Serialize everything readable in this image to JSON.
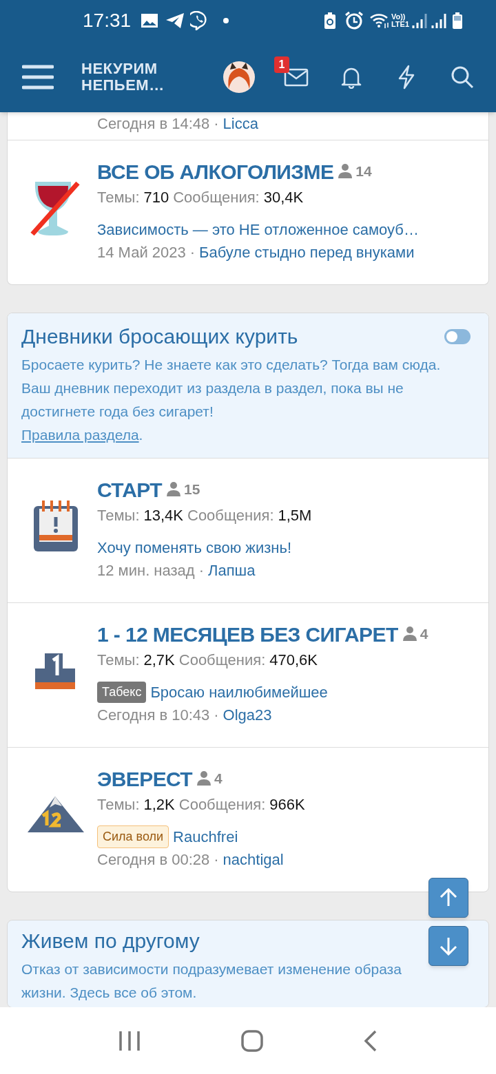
{
  "status_bar": {
    "time": "17:31",
    "volte": "Vo))",
    "network": "LTE1"
  },
  "header": {
    "logo": "НЕКУРИМ НЕПЬЕМ…",
    "inbox_badge": "1"
  },
  "sections": [
    {
      "forums": [
        {
          "kind": "partial",
          "date": "Сегодня в 14:48",
          "separator": "·",
          "author": "Licca"
        },
        {
          "kind": "full",
          "title": "ВСЕ ОБ АЛКОГОЛИЗМЕ",
          "viewers": "14",
          "topics_label": "Темы:",
          "topics": "710",
          "messages_label": "Сообщения:",
          "messages": "30,4K",
          "last_title": "Зависимость — это НЕ отложенное самоуб…",
          "date": "14 Май 2023",
          "separator": "·",
          "author": "Бабуле стыдно перед внуками"
        }
      ]
    },
    {
      "title": "Дневники бросающих курить",
      "collapsed": false,
      "description": "Бросаете курить? Не знаете как это сделать? Тогда вам сюда. Ваш дневник переходит из раздела в раздел, пока вы не достигнете года без сигарет!",
      "rules_link": "Правила раздела",
      "rules_suffix": ".",
      "forums": [
        {
          "kind": "full",
          "title": "СТАРТ",
          "viewers": "15",
          "topics_label": "Темы:",
          "topics": "13,4K",
          "messages_label": "Сообщения:",
          "messages": "1,5M",
          "last_title": "Хочу поменять свою жизнь!",
          "date": "12 мин. назад",
          "separator": "·",
          "author": "Лапша"
        },
        {
          "kind": "full",
          "title": "1 - 12 МЕСЯЦЕВ БЕЗ СИГАРЕТ",
          "viewers": "4",
          "topics_label": "Темы:",
          "topics": "2,7K",
          "messages_label": "Сообщения:",
          "messages": "470,6K",
          "prefix": {
            "label": "Табекс",
            "color": "#777777"
          },
          "last_title": "Бросаю наилюбимейшее",
          "date": "Сегодня в 10:43",
          "separator": "·",
          "author": "Olga23"
        },
        {
          "kind": "full",
          "title": "ЭВЕРЕСТ",
          "viewers": "4",
          "topics_label": "Темы:",
          "topics": "1,2K",
          "messages_label": "Сообщения:",
          "messages": "966K",
          "prefix": {
            "label": "Сила воли",
            "color": "#fdf2dc"
          },
          "last_title": "Rauchfrei",
          "date": "Сегодня в 00:28",
          "separator": "·",
          "author": "nachtigal"
        }
      ]
    },
    {
      "title": "Живем по другому",
      "description": "Отказ от зависимости подразумевает изменение образа жизни. Здесь все об этом."
    }
  ]
}
